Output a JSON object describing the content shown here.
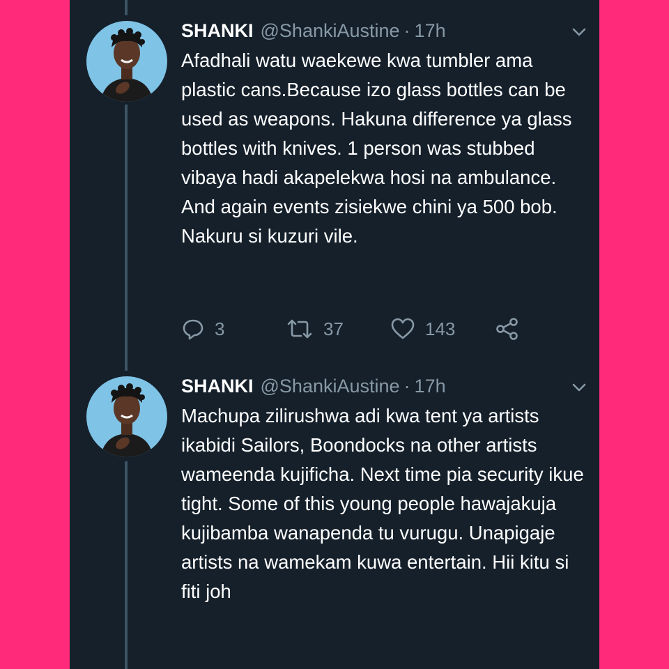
{
  "colors": {
    "page_background": "#ff2b7a",
    "panel_background": "#15202b",
    "text_primary": "#ffffff",
    "text_secondary": "#8899a6",
    "thread_line": "#3d5466",
    "avatar_background": "#7fc3e6"
  },
  "tweets": [
    {
      "name": "SHANKI",
      "handle": "@ShankiAustine",
      "separator": "·",
      "time": "17h",
      "text": "Afadhali watu waekewe kwa tumbler ama plastic cans.Because izo glass bottles can be used as weapons. Hakuna difference ya glass bottles with knives. 1 person was stubbed vibaya hadi akapelekwa hosi na ambulance. And again events zisiekwe chini ya 500 bob. Nakuru si kuzuri vile.",
      "replies": "3",
      "retweets": "37",
      "likes": "143",
      "icons": [
        "avatar",
        "chevron-down-icon",
        "reply-icon",
        "retweet-icon",
        "heart-icon",
        "share-icon"
      ]
    },
    {
      "name": "SHANKI",
      "handle": "@ShankiAustine",
      "separator": "·",
      "time": "17h",
      "text": "Machupa zilirushwa adi kwa tent ya artists ikabidi Sailors, Boondocks na other artists wameenda kujificha. Next time pia security ikue tight. Some of this young people hawajakuja kujibamba wanapenda tu vurugu. Unapigaje artists na wamekam kuwa entertain. Hii kitu si fiti joh",
      "icons": [
        "avatar",
        "chevron-down-icon"
      ]
    }
  ]
}
